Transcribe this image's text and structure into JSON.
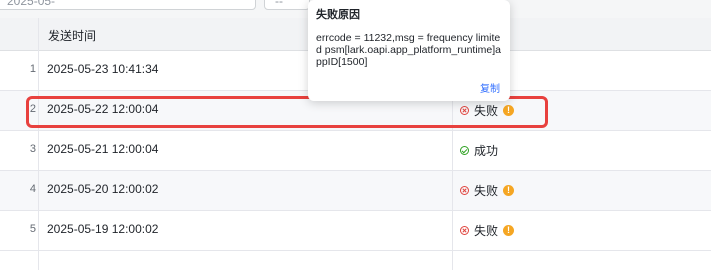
{
  "filters": {
    "start_placeholder": "2025-05-",
    "end_placeholder": "--"
  },
  "table": {
    "header": {
      "send_time": "发送时间"
    },
    "rows": [
      {
        "index": "1",
        "time": "2025-05-23 10:41:34",
        "status": ""
      },
      {
        "index": "2",
        "time": "2025-05-22 12:00:04",
        "status": "失败"
      },
      {
        "index": "3",
        "time": "2025-05-21 12:00:04",
        "status": "成功"
      },
      {
        "index": "4",
        "time": "2025-05-20 12:00:02",
        "status": "失败"
      },
      {
        "index": "5",
        "time": "2025-05-19 12:00:02",
        "status": "失败"
      }
    ]
  },
  "tooltip": {
    "title": "失败原因",
    "body": "errcode = 11232,msg = frequency limited psm[lark.oapi.app_platform_runtime]appID[1500]",
    "copy_label": "复制"
  },
  "colors": {
    "fail": "#e0443e",
    "success": "#2ea121",
    "info": "#f5a623",
    "highlight": "#e8413e",
    "link": "#3370ff"
  },
  "icons": {
    "fail": "fail-icon",
    "success": "success-icon",
    "info": "info-icon"
  }
}
